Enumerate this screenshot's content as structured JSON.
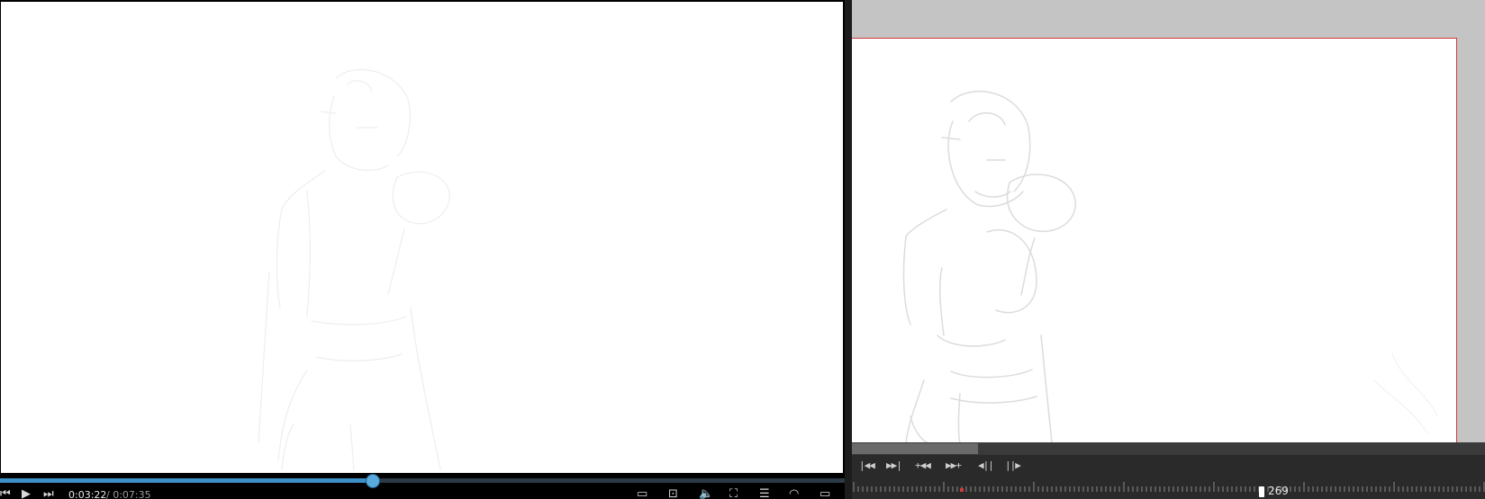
{
  "player": {
    "progress": 0.445,
    "current_time": "0:03:22",
    "total_time": "/ 0:07:35",
    "controls": [
      "prev-icon",
      "play-icon",
      "next-icon"
    ],
    "right_icons": [
      "subtitles-icon",
      "crop-icon",
      "volume-icon",
      "fullscreen-icon",
      "playlist-icon",
      "cast-icon",
      "settings-icon"
    ]
  },
  "editor": {
    "transport_buttons": [
      "|◀◀",
      "▶▶|",
      "+◀◀",
      "▶▶+",
      "◀||",
      "||▶"
    ],
    "current_frame": "269",
    "scroll_fraction": 0.2,
    "colors": {
      "border_red": "#d23a3a",
      "accent_blue": "#3d8fc7"
    }
  }
}
